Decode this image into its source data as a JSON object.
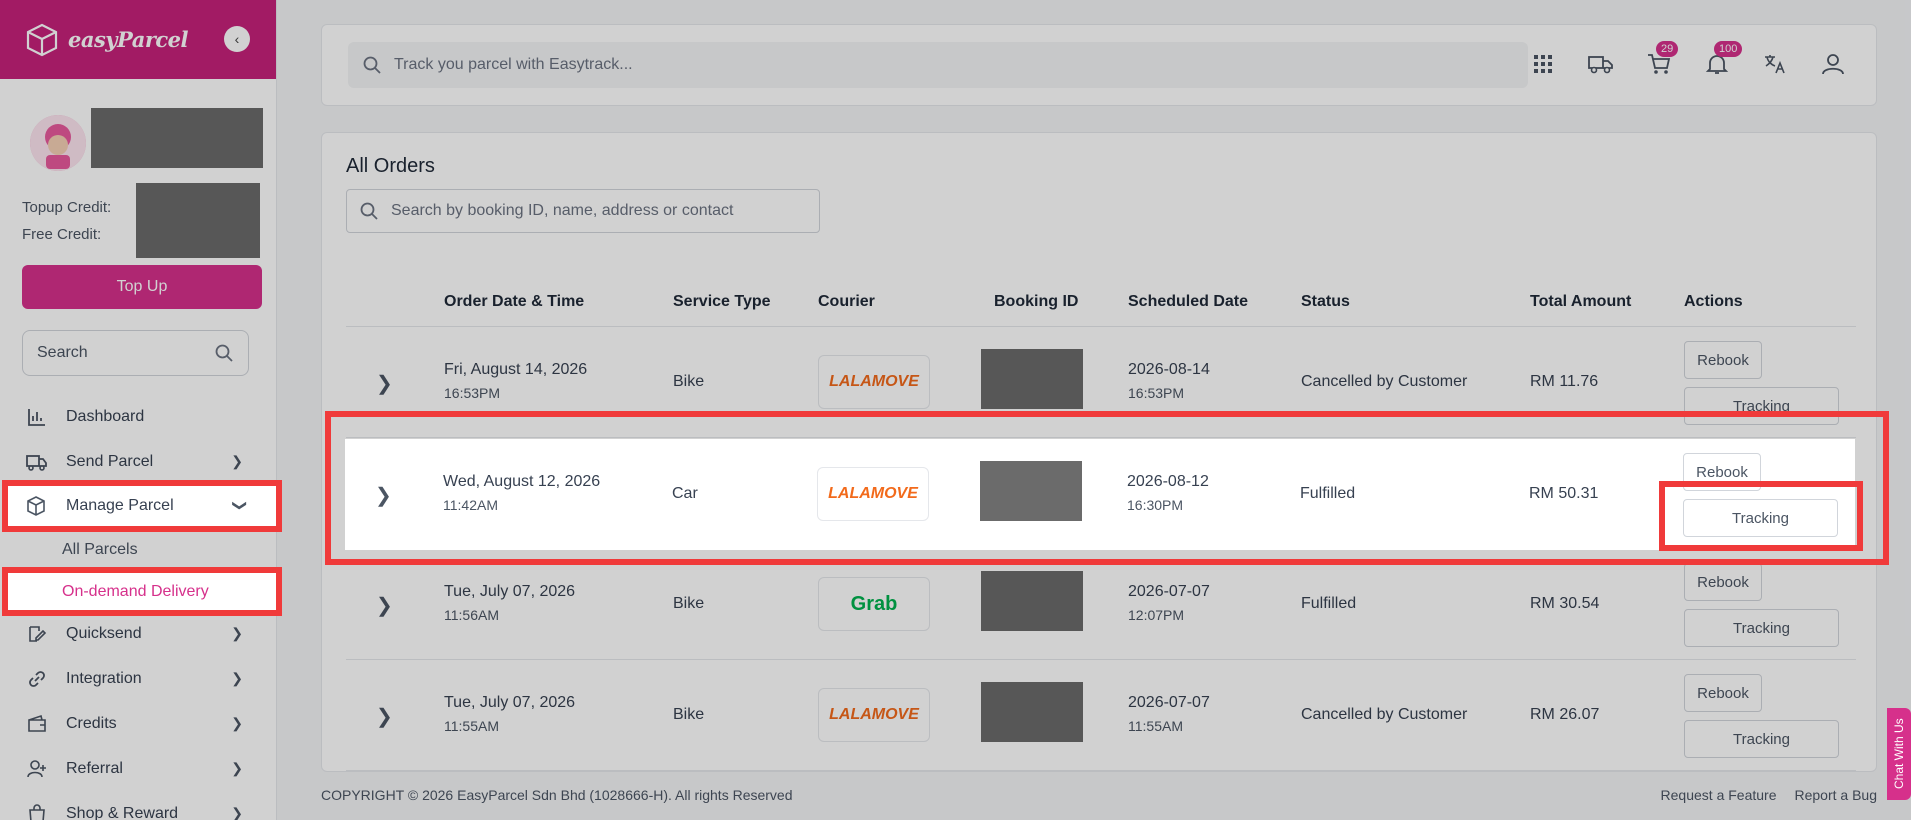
{
  "brand": {
    "name": "easyParcel"
  },
  "sidebar": {
    "credits": {
      "topup_label": "Topup Credit:",
      "free_label": "Free Credit:"
    },
    "topup_button": "Top Up",
    "search_placeholder": "Search",
    "items": [
      {
        "label": "Dashboard",
        "icon": "bar-chart-icon"
      },
      {
        "label": "Send Parcel",
        "icon": "truck-icon"
      },
      {
        "label": "Manage Parcel",
        "icon": "box-icon"
      },
      {
        "label": "Quicksend",
        "icon": "edit-icon"
      },
      {
        "label": "Integration",
        "icon": "link-icon"
      },
      {
        "label": "Credits",
        "icon": "wallet-icon"
      },
      {
        "label": "Referral",
        "icon": "user-plus-icon"
      },
      {
        "label": "Shop & Reward",
        "icon": "shopping-bag-icon"
      }
    ],
    "sub_items": [
      {
        "label": "All Parcels"
      },
      {
        "label": "On-demand Delivery"
      }
    ]
  },
  "header": {
    "search_placeholder": "Track you parcel with Easytrack...",
    "cart_count": "29",
    "notification_count": "100"
  },
  "orders": {
    "title": "All Orders",
    "search_placeholder": "Search by booking ID, name, address or contact",
    "columns": [
      "Order Date & Time",
      "Service Type",
      "Courier",
      "Booking ID",
      "Scheduled Date",
      "Status",
      "Total Amount",
      "Actions"
    ],
    "rebook_label": "Rebook",
    "tracking_label": "Tracking",
    "rows": [
      {
        "date": "Fri, August 14, 2026",
        "time": "16:53PM",
        "service": "Bike",
        "courier": "LALAMOVE",
        "sched_date": "2026-08-14",
        "sched_time": "16:53PM",
        "status": "Cancelled by Customer",
        "amount": "RM 11.76"
      },
      {
        "date": "Wed, August 12, 2026",
        "time": "11:42AM",
        "service": "Car",
        "courier": "LALAMOVE",
        "sched_date": "2026-08-12",
        "sched_time": "16:30PM",
        "status": "Fulfilled",
        "amount": "RM 50.31"
      },
      {
        "date": "Tue, July 07, 2026",
        "time": "11:56AM",
        "service": "Bike",
        "courier": "Grab",
        "sched_date": "2026-07-07",
        "sched_time": "12:07PM",
        "status": "Fulfilled",
        "amount": "RM 30.54"
      },
      {
        "date": "Tue, July 07, 2026",
        "time": "11:55AM",
        "service": "Bike",
        "courier": "LALAMOVE",
        "sched_date": "2026-07-07",
        "sched_time": "11:55AM",
        "status": "Cancelled by Customer",
        "amount": "RM 26.07"
      }
    ]
  },
  "footer": {
    "copyright": "COPYRIGHT © 2026 EasyParcel Sdn Bhd (1028666-H). All rights Reserved",
    "links": [
      "Request a Feature",
      "Report a Bug"
    ]
  },
  "chat_tab": "Chat With Us",
  "colors": {
    "brand": "#c6217a",
    "accent": "#d6308b",
    "annotation": "#f03a3a"
  }
}
